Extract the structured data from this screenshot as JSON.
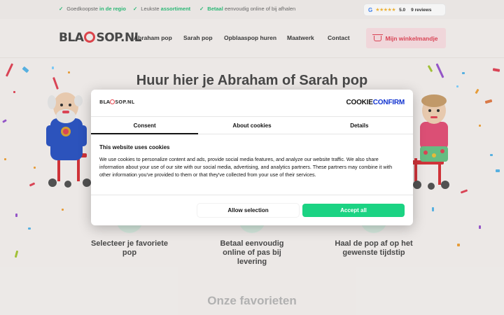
{
  "topbar": {
    "usps": [
      {
        "before": "Goedkoopste ",
        "highlight": "in de regio",
        "after": ""
      },
      {
        "before": "Leukste ",
        "highlight": "assortiment",
        "after": ""
      },
      {
        "before": "",
        "highlight": "Betaal",
        "after": " eenvoudig online of bij afhalen"
      }
    ],
    "reviews": {
      "provider": "G",
      "stars": "★★★★★",
      "score": "5.0",
      "count": "9 reviews"
    }
  },
  "header": {
    "logo": {
      "part1": "BLA",
      "part2": "SOP.NL"
    },
    "nav": [
      "Abraham pop",
      "Sarah pop",
      "Opblaaspop huren",
      "Maatwerk",
      "Contact"
    ],
    "cart_label": "Mijn winkelmandje"
  },
  "hero": {
    "title": "Huur hier je Abraham of Sarah pop"
  },
  "steps": [
    {
      "line1": "Selecteer je favoriete",
      "line2": "pop",
      "line3": ""
    },
    {
      "line1": "Betaal eenvoudig",
      "line2": "online of pas bij",
      "line3": "levering"
    },
    {
      "line1": "Haal de pop af op het",
      "line2": "gewenste tijdstip",
      "line3": ""
    }
  ],
  "favorites": {
    "title": "Onze favorieten"
  },
  "cookie": {
    "brand_logo": {
      "part1": "BLA",
      "part2": "SOP.NL"
    },
    "provider_logo": {
      "part1": "C",
      "part2": "OOKIE",
      "part3": "CONFIRM"
    },
    "tabs": [
      "Consent",
      "About cookies",
      "Details"
    ],
    "active_tab": "Consent",
    "heading": "This website uses cookies",
    "body": "We use cookies to personalize content and ads, provide social media features, and analyze our website traffic. We also share information about your use of our site with our social media, advertising, and analytics partners. These partners may combine it with other information you've provided to them or that they've collected from your use of their services.",
    "allow_selection": "Allow selection",
    "accept_all": "Accept all"
  },
  "colors": {
    "accent_green": "#1bd383",
    "brand_red": "#e4474f",
    "cart_bg": "#fadfe3",
    "check_green": "#2dbf7a"
  },
  "icons": [
    "check-icon",
    "google-icon",
    "star-icon",
    "shopping-bag-icon"
  ]
}
